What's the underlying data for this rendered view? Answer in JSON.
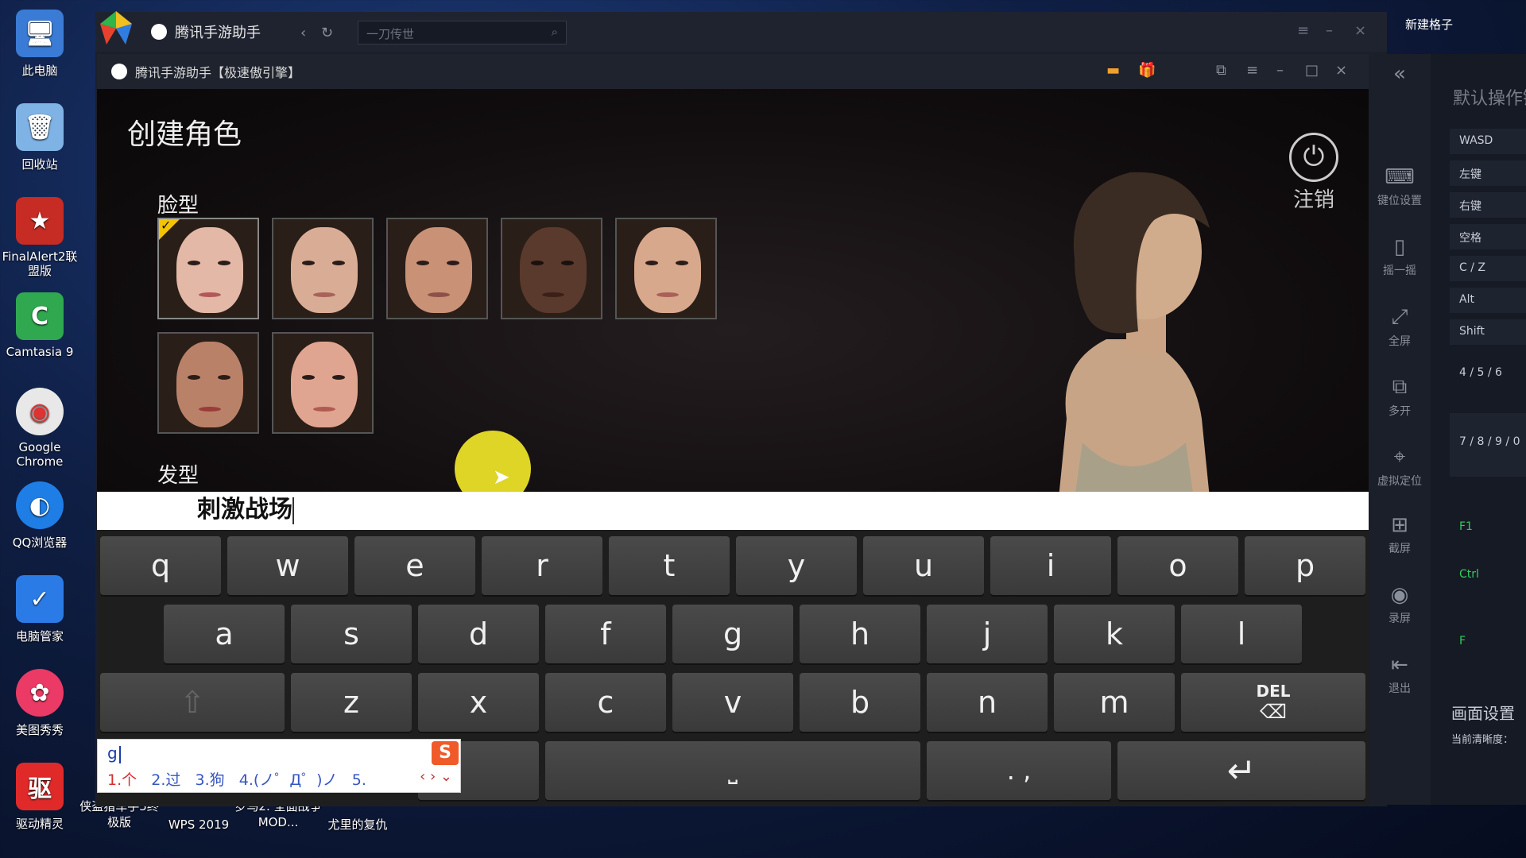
{
  "desktop": {
    "icons": [
      {
        "label": "此电脑",
        "symbol": "🖥",
        "color": "#3a7bd5"
      },
      {
        "label": "回收站",
        "symbol": "🗑",
        "color": "#7fb3e6"
      },
      {
        "label": "FinalAlert2联盟版",
        "symbol": "★",
        "color": "#c62b24"
      },
      {
        "label": "Camtasia 9",
        "symbol": "C",
        "color": "#2fa84f"
      },
      {
        "label": "Google Chrome",
        "symbol": "◉",
        "color": "#e8e8e8"
      },
      {
        "label": "QQ浏览器",
        "symbol": "◐",
        "color": "#1e7ee6"
      },
      {
        "label": "电脑管家",
        "symbol": "✓",
        "color": "#2b7be6"
      },
      {
        "label": "美图秀秀",
        "symbol": "✿",
        "color": "#ea3a65"
      },
      {
        "label": "驱动精灵",
        "symbol": "驱",
        "color": "#e02a2a"
      }
    ],
    "bottom_icons": [
      {
        "label": "侠盗猎车手5终极版"
      },
      {
        "label": "WPS 2019"
      },
      {
        "label": "罗马2: 全面战争 MOD..."
      },
      {
        "label": "尤里的复仇"
      }
    ],
    "top_right_label": "新建格子"
  },
  "outer_window": {
    "title": "腾讯手游助手",
    "search_placeholder": "一刀传世",
    "back_icon": "‹",
    "refresh_icon": "↻"
  },
  "inner_window": {
    "title": "腾讯手游助手【极速傲引擎】"
  },
  "game": {
    "title": "创建角色",
    "face_label": "脸型",
    "hair_label": "发型",
    "logout_label": "注销",
    "faces": [
      {
        "skin": "#e3b8a6"
      },
      {
        "skin": "#d9ad95"
      },
      {
        "skin": "#c99277"
      },
      {
        "skin": "#5a3a2c"
      },
      {
        "skin": "#d8a88d"
      },
      {
        "skin": "#b98268"
      },
      {
        "skin": "#e0a590"
      }
    ],
    "selected_face": 0
  },
  "input": {
    "text": "刺激战场"
  },
  "keyboard": {
    "row1": [
      "q",
      "w",
      "e",
      "r",
      "t",
      "y",
      "u",
      "i",
      "o",
      "p"
    ],
    "row2": [
      "a",
      "s",
      "d",
      "f",
      "g",
      "h",
      "j",
      "k",
      "l"
    ],
    "row3": [
      "z",
      "x",
      "c",
      "v",
      "b",
      "n",
      "m"
    ],
    "del_label": "DEL",
    "punct_label": ". ,"
  },
  "ime": {
    "typed": "g",
    "candidates": [
      "1.个",
      "2.过",
      "3.狗",
      "4.(ノ゜Д゜)ノ",
      "5."
    ],
    "logo": "S"
  },
  "side_toolbar": [
    {
      "label": "键位设置",
      "icon": "⌨"
    },
    {
      "label": "摇一摇",
      "icon": "▯"
    },
    {
      "label": "全屏",
      "icon": "⤢"
    },
    {
      "label": "多开",
      "icon": "⧉"
    },
    {
      "label": "虚拟定位",
      "icon": "⌖"
    },
    {
      "label": "截屏",
      "icon": "⊞"
    },
    {
      "label": "录屏",
      "icon": "◉"
    },
    {
      "label": "退出",
      "icon": "⇤"
    }
  ],
  "keymap": {
    "title": "默认操作键",
    "keys": [
      "WASD",
      "左键",
      "右键",
      "空格",
      "C / Z",
      "Alt",
      "Shift"
    ],
    "number_keys": [
      "4 / 5 / 6",
      "7 / 8 / 9 / 0"
    ],
    "green_keys": [
      "F1",
      "Ctrl",
      "F"
    ],
    "screen_settings": "画面设置",
    "clarity": "当前清晰度："
  }
}
